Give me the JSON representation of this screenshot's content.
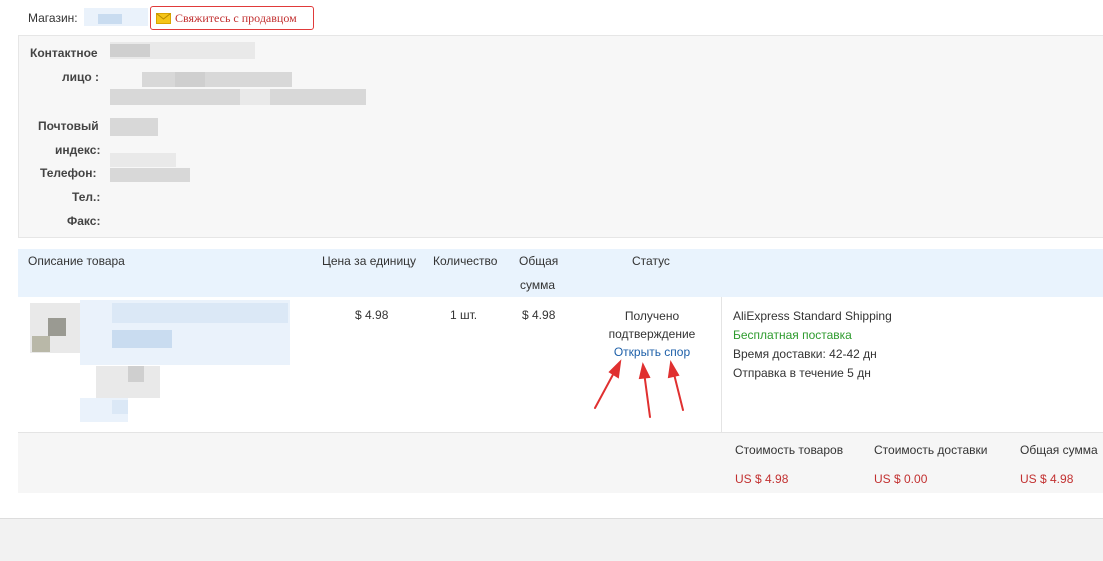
{
  "store": {
    "label": "Магазин:",
    "contact_button": "Свяжитесь с продавцом"
  },
  "contact": {
    "person_label_1": "Контактное",
    "person_label_2": "лицо :",
    "postal_label_1": "Почтовый",
    "postal_label_2": "индекс:",
    "phone_label": "Телефон:",
    "tel_label": "Тел.:",
    "fax_label": "Факс:"
  },
  "table": {
    "headers": {
      "description": "Описание товара",
      "unit_price": "Цена за единицу",
      "quantity": "Количество",
      "total_1": "Общая",
      "total_2": "сумма",
      "status": "Статус"
    },
    "row": {
      "unit_price": "$ 4.98",
      "quantity": "1 шт.",
      "total": "$ 4.98",
      "status_1": "Получено",
      "status_2": "подтверждение",
      "dispute_link": "Открыть спор",
      "shipping_method": "AliExpress Standard Shipping",
      "free_shipping": "Бесплатная поставка",
      "delivery_time": "Время доставки: 42-42 дн",
      "dispatch": "Отправка в течение 5 дн"
    }
  },
  "totals": {
    "goods_label": "Стоимость товаров",
    "goods_value": "US $ 4.98",
    "shipping_label": "Стоимость доставки",
    "shipping_value": "US $ 0.00",
    "total_label": "Общая сумма",
    "total_value": "US $ 4.98"
  },
  "colors": {
    "accent_red": "#c23030",
    "link_blue": "#1d5fa8",
    "free_green": "#2e9b2e",
    "arrow_red": "#e03030"
  },
  "icons": {
    "contact": "mail-icon",
    "annotation": "arrow-up-icon"
  }
}
